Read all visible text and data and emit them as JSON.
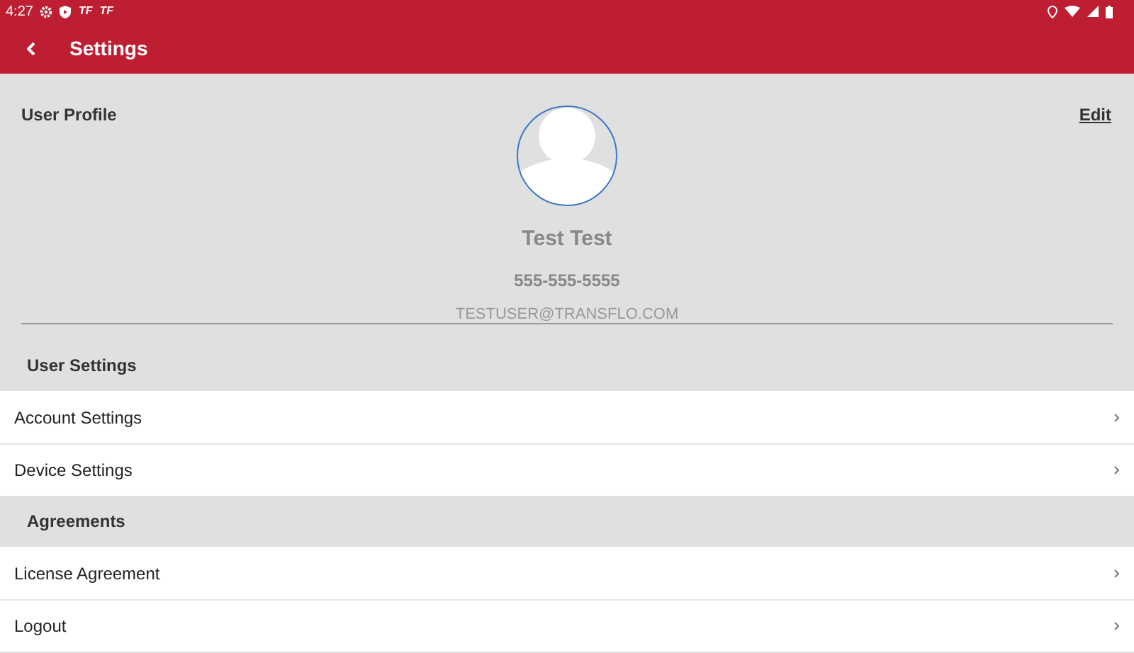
{
  "status_bar": {
    "time": "4:27",
    "notifications": [
      "TF",
      "TF"
    ]
  },
  "app_bar": {
    "title": "Settings"
  },
  "profile": {
    "heading": "User Profile",
    "edit": "Edit",
    "name": "Test Test",
    "phone": "555-555-5555",
    "email": "TESTUSER@TRANSFLO.COM"
  },
  "sections": [
    {
      "title": "User Settings",
      "items": [
        "Account Settings",
        "Device Settings"
      ]
    },
    {
      "title": "Agreements",
      "items": [
        "License Agreement",
        "Logout"
      ]
    }
  ]
}
